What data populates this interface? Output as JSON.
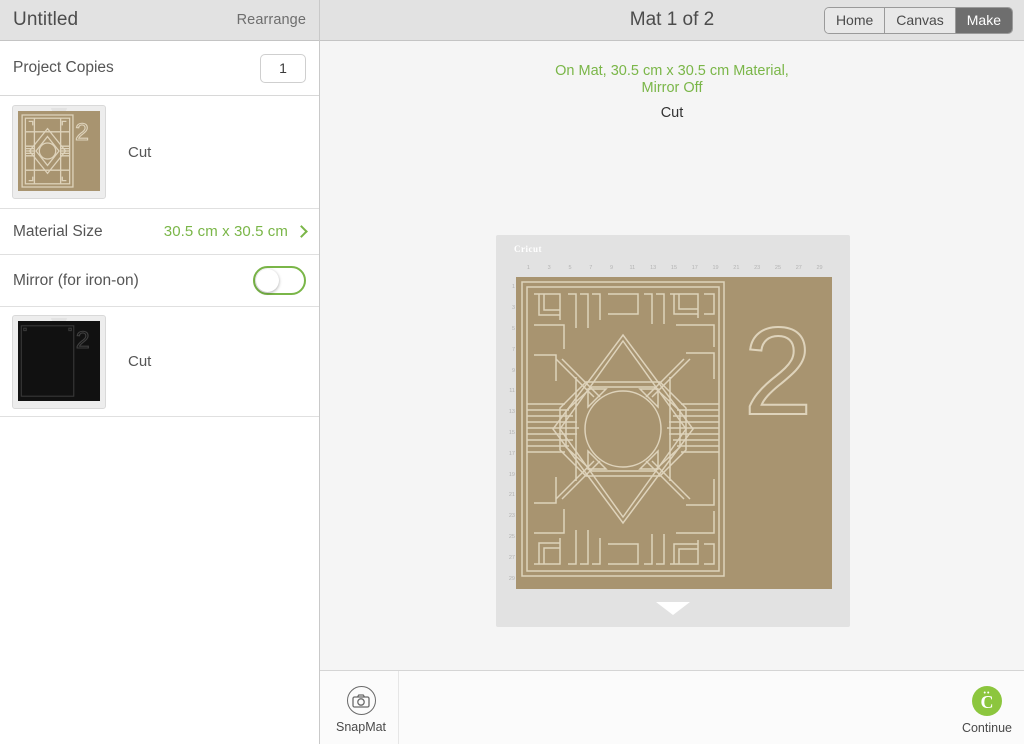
{
  "sidebar": {
    "title": "Untitled",
    "rearrange_label": "Rearrange",
    "project_copies": {
      "label": "Project Copies",
      "value": "1"
    },
    "mats": [
      {
        "label": "Cut",
        "material_color": "#a89470",
        "kind": "tan"
      },
      {
        "label": "Cut",
        "material_color": "#111111",
        "kind": "black"
      }
    ],
    "material_size": {
      "label": "Material Size",
      "value": "30.5 cm x 30.5 cm",
      "chevron_icon": "chevron-right-icon"
    },
    "mirror": {
      "label": "Mirror (for iron-on)",
      "state": "off"
    }
  },
  "header": {
    "mat_title": "Mat 1 of 2",
    "segments": [
      {
        "label": "Home",
        "active": false
      },
      {
        "label": "Canvas",
        "active": false
      },
      {
        "label": "Make",
        "active": true
      }
    ]
  },
  "canvas": {
    "status_line1": "On Mat, 30.5 cm x 30.5 cm Material,",
    "status_line2": "Mirror Off",
    "operation": "Cut",
    "mat_brand": "Cricut",
    "ruler_top": [
      "1",
      "3",
      "5",
      "7",
      "9",
      "11",
      "13",
      "15",
      "17",
      "19",
      "21",
      "23",
      "25",
      "27",
      "29"
    ],
    "ruler_left": [
      "1",
      "3",
      "5",
      "7",
      "9",
      "11",
      "13",
      "15",
      "17",
      "19",
      "21",
      "23",
      "25",
      "27",
      "29"
    ],
    "design_numeral": "2",
    "material_color": "#a89470",
    "cut_line_color": "#ded3bb"
  },
  "bottom_bar": {
    "snapmat": {
      "label": "SnapMat",
      "icon": "camera-icon"
    },
    "continue": {
      "label": "Continue",
      "icon": "cricut-logo-icon",
      "color": "#8cc63e"
    }
  },
  "colors": {
    "accent_green": "#7ab648",
    "brand_green": "#8cc63e",
    "chrome_gray": "#e2e2e2",
    "material_tan": "#a89470"
  }
}
